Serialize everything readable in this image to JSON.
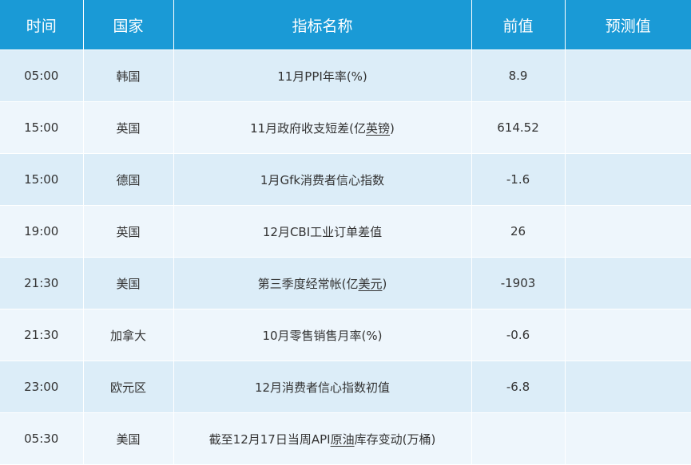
{
  "table": {
    "headers": [
      "时间",
      "国家",
      "指标名称",
      "前值",
      "预测值"
    ],
    "rows": [
      {
        "time": "05:00",
        "country": "韩国",
        "name_a": "11月PPI年率(%)",
        "name_u": "",
        "name_b": "",
        "prev": "8.9",
        "forecast": ""
      },
      {
        "time": "15:00",
        "country": "英国",
        "name_a": "11月政府收支短差(亿",
        "name_u": "英镑",
        "name_b": ")",
        "prev": "614.52",
        "forecast": ""
      },
      {
        "time": "15:00",
        "country": "德国",
        "name_a": "1月Gfk消费者信心指数",
        "name_u": "",
        "name_b": "",
        "prev": "-1.6",
        "forecast": ""
      },
      {
        "time": "19:00",
        "country": "英国",
        "name_a": "12月CBI工业订单差值",
        "name_u": "",
        "name_b": "",
        "prev": "26",
        "forecast": ""
      },
      {
        "time": "21:30",
        "country": "美国",
        "name_a": "第三季度经常帐(亿",
        "name_u": "美元",
        "name_b": ")",
        "prev": "-1903",
        "forecast": ""
      },
      {
        "time": "21:30",
        "country": "加拿大",
        "name_a": "10月零售销售月率(%)",
        "name_u": "",
        "name_b": "",
        "prev": "-0.6",
        "forecast": ""
      },
      {
        "time": "23:00",
        "country": "欧元区",
        "name_a": "12月消费者信心指数初值",
        "name_u": "",
        "name_b": "",
        "prev": "-6.8",
        "forecast": ""
      },
      {
        "time": "05:30",
        "country": "美国",
        "name_a": "截至12月17日当周API",
        "name_u": "原油",
        "name_b": "库存变动(万桶)",
        "prev": "",
        "forecast": ""
      }
    ]
  }
}
